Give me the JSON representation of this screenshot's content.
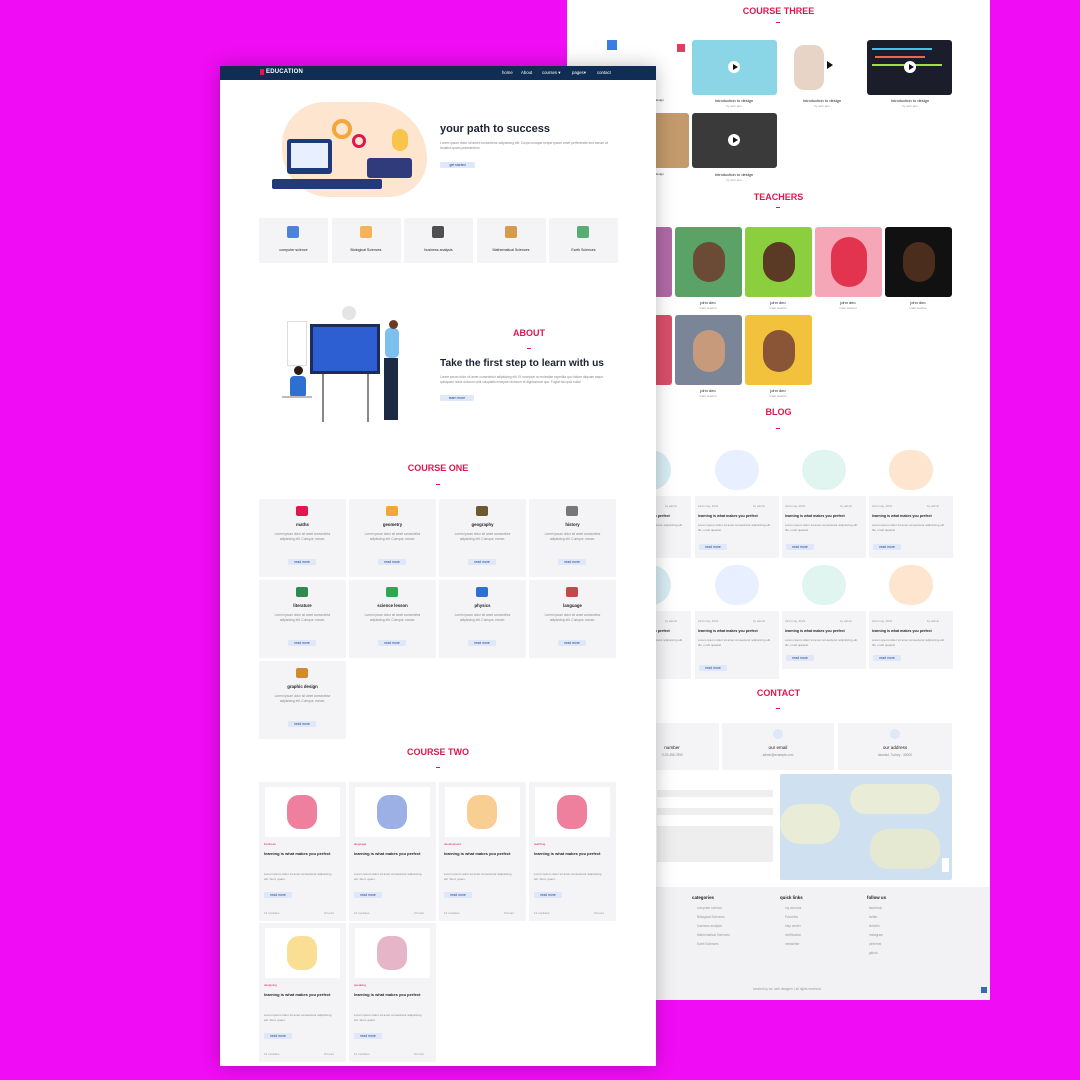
{
  "brand": "EDUCATION",
  "nav": [
    "home",
    "About",
    "courses",
    "pages",
    "contact"
  ],
  "hero": {
    "title": "your path to success",
    "text": "Lorem ipsum dolor sit amet consectetur adipisicing elit. Culpa cumque neque ipsum amet perferendis sed earum at fanatics quam praesentium.",
    "button": "get started"
  },
  "categories": [
    "computer science",
    "Biological Sciences",
    "business analysis",
    "Mathematical Sciences",
    "Earth Sciences"
  ],
  "about": {
    "heading": "ABOUT",
    "title": "Take the first step to learn with us",
    "text": "Lorem ipsum dolor sit amet consectetur adipisicing elit. Et excepturi at molestiae expedita quo labore aliquam atque quisquam nobis dolorum velit voluptatis excepturi dolorum et dignissimos quo. Fugiat nisi quis nulla!",
    "button": "learn more"
  },
  "course_one": {
    "heading": "COURSE ONE",
    "desc": "Lorem ipsum dolor sit amet consectetur adipisicing elit. Cumque, earum.",
    "button": "read more",
    "items": [
      "maths",
      "geometry",
      "geography",
      "history",
      "literature",
      "science lesson",
      "physics",
      "language",
      "graphic design"
    ]
  },
  "course_two": {
    "heading": "COURSE TWO",
    "title": "learning is what makes you perfect",
    "desc": "Lorem ipsum dolor sit amet consectetur adipisicing elit. Sunt, quam.",
    "button": "read more",
    "modules": "12 modules",
    "hours": "9 hours",
    "tags": [
      "business",
      "language",
      "development",
      "teaching",
      "designing",
      "speaking"
    ]
  },
  "course_three": {
    "heading": "COURSE THREE",
    "title": "Introduction to design",
    "author": "by john deo",
    "partial": "design"
  },
  "teachers": {
    "heading": "TEACHERS",
    "name": "john deo",
    "role": "math teacher"
  },
  "blog": {
    "heading": "BLOG",
    "title": "learning is what makes you perfect",
    "date": "21st may, 2021",
    "author": "by admin",
    "desc": "Lorem ipsum dolor sit amet consectetur adipisicing elit. Illo, modi quaerat",
    "button": "read more"
  },
  "contact": {
    "heading": "CONTACT",
    "cards": [
      "number",
      "our email",
      "our address"
    ],
    "number": "+123-456-7890",
    "email": "admin@example.com",
    "address": "istanbul, Turkey - 34000"
  },
  "footer": {
    "categories": {
      "heading": "categories",
      "items": [
        "computer science",
        "Biological Sciences",
        "business analysis",
        "Mathematical Sciences",
        "Earth Sciences"
      ]
    },
    "links": {
      "heading": "quick links",
      "items": [
        "my account",
        "Favorites",
        "help center",
        "certification",
        "newsletter"
      ]
    },
    "follow": {
      "heading": "follow us",
      "items": [
        "facebook",
        "twitter",
        "linkedin",
        "instagram",
        "pinterest",
        "github"
      ]
    },
    "credit": "created by mr. web designer | all rights reserved"
  },
  "colors": {
    "nav": "#0f2d55",
    "accent": "#e0174e",
    "card": "#f4f4f6",
    "button": "#dfe8f8",
    "background": "#f00cf4"
  }
}
